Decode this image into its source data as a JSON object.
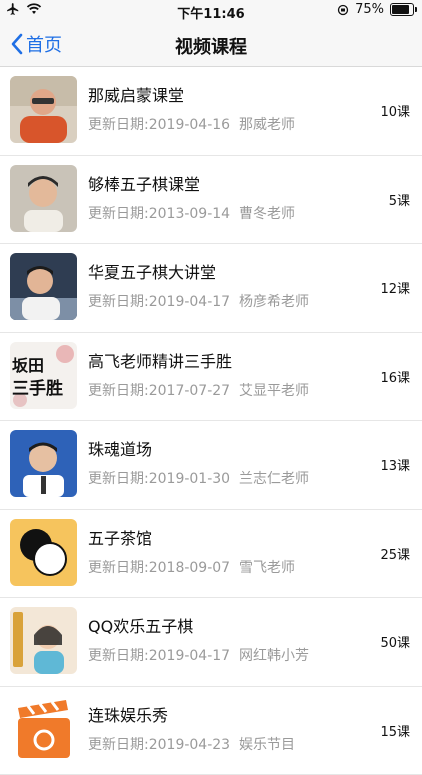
{
  "status_bar": {
    "time": "下午11:46",
    "battery": "75%"
  },
  "nav": {
    "back_label": "首页",
    "title": "视频课程"
  },
  "courses": [
    {
      "title": "那威启蒙课堂",
      "update_label": "更新日期:",
      "date": "2019-04-16",
      "teacher": "那威老师",
      "count": "10课"
    },
    {
      "title": "够棒五子棋课堂",
      "update_label": "更新日期:",
      "date": "2013-09-14",
      "teacher": "曹冬老师",
      "count": "5课"
    },
    {
      "title": "华夏五子棋大讲堂",
      "update_label": "更新日期:",
      "date": "2019-04-17",
      "teacher": "杨彦希老师",
      "count": "12课"
    },
    {
      "title": "高飞老师精讲三手胜",
      "update_label": "更新日期:",
      "date": "2017-07-27",
      "teacher": "艾显平老师",
      "count": "16课",
      "thumb_text_top": "坂田",
      "thumb_text_bottom": "三手胜"
    },
    {
      "title": "珠魂道场",
      "update_label": "更新日期:",
      "date": "2019-01-30",
      "teacher": "兰志仁老师",
      "count": "13课"
    },
    {
      "title": "五子茶馆",
      "update_label": "更新日期:",
      "date": "2018-09-07",
      "teacher": "雪飞老师",
      "count": "25课"
    },
    {
      "title": "QQ欢乐五子棋",
      "update_label": "更新日期:",
      "date": "2019-04-17",
      "teacher": "网红韩小芳",
      "count": "50课"
    },
    {
      "title": "连珠娱乐秀",
      "update_label": "更新日期:",
      "date": "2019-04-23",
      "teacher": "娱乐节目",
      "count": "15课"
    }
  ],
  "colors": {
    "accent": "#1f6fe5",
    "subtext": "#9a9a9a",
    "divider": "#e6e6e6"
  }
}
